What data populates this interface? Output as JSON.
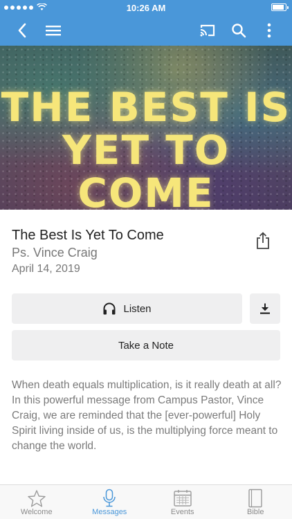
{
  "status_bar": {
    "time": "10:26 AM",
    "battery_level": 0.95
  },
  "nav": {
    "back_icon": "chevron-left-icon",
    "menu_icon": "hamburger-icon",
    "cast_icon": "cast-icon",
    "search_icon": "search-icon",
    "more_icon": "more-vertical-icon"
  },
  "hero": {
    "line1": "THE BEST IS",
    "line2": "YET TO COME"
  },
  "message": {
    "title": "The Best Is Yet To Come",
    "speaker": "Ps. Vince Craig",
    "date": "April 14, 2019",
    "description": "When death equals multiplication, is it really death at all? In this powerful message from Campus Pastor, Vince Craig,  we are reminded that the [ever-powerful] Holy Spirit living inside of us, is the multiplying force meant to change the world."
  },
  "actions": {
    "listen_label": "Listen",
    "take_note_label": "Take a Note"
  },
  "tabs": [
    {
      "label": "Welcome",
      "icon": "star-icon"
    },
    {
      "label": "Messages",
      "icon": "microphone-icon"
    },
    {
      "label": "Events",
      "icon": "calendar-icon"
    },
    {
      "label": "Bible",
      "icon": "book-icon"
    }
  ],
  "colors": {
    "accent": "#4a97d9",
    "hero_text": "#f6e67a"
  }
}
